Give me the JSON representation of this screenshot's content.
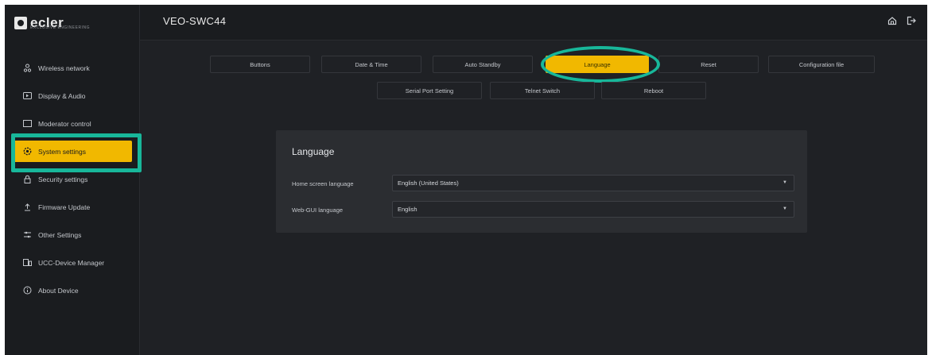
{
  "brand": {
    "logo_text": "ecler",
    "logo_sub": "EXCLUSIVE ENGINEERING"
  },
  "header": {
    "device_title": "VEO-SWC44",
    "home_icon": "home-icon",
    "logout_icon": "logout-icon"
  },
  "sidebar": {
    "items": [
      {
        "label": "Wireless network",
        "icon": "wifi-icon"
      },
      {
        "label": "Display & Audio",
        "icon": "display-icon"
      },
      {
        "label": "Moderator control",
        "icon": "monitor-icon"
      },
      {
        "label": "System settings",
        "icon": "gear-icon",
        "active": true
      },
      {
        "label": "Security settings",
        "icon": "lock-icon"
      },
      {
        "label": "Firmware Update",
        "icon": "upload-icon"
      },
      {
        "label": "Other Settings",
        "icon": "sliders-icon"
      },
      {
        "label": "UCC-Device Manager",
        "icon": "device-icon"
      },
      {
        "label": "About Device",
        "icon": "info-icon"
      }
    ]
  },
  "tabs": {
    "row1": [
      "Buttons",
      "Date & Time",
      "Auto Standby",
      "Language",
      "Reset",
      "Configuration file"
    ],
    "row2": [
      "Serial Port Setting",
      "Telnet Switch",
      "Reboot"
    ],
    "active": "Language"
  },
  "panel": {
    "title": "Language",
    "fields": [
      {
        "label": "Home screen language",
        "value": "English (United States)"
      },
      {
        "label": "Web-GUI language",
        "value": "English"
      }
    ]
  },
  "colors": {
    "accent": "#f1b800",
    "highlight": "#18b79a",
    "background": "#1f2125",
    "panel": "#2b2d31"
  }
}
